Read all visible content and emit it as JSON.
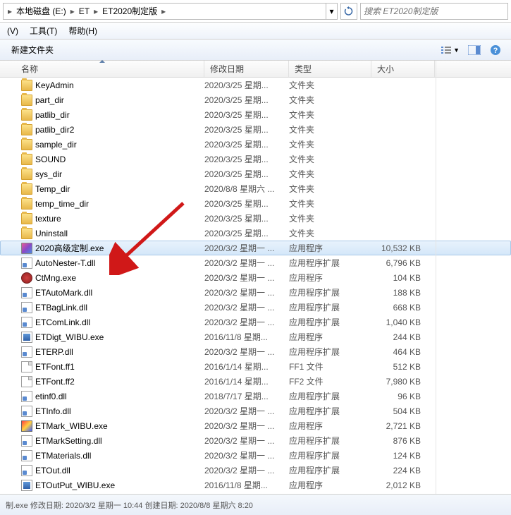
{
  "breadcrumb": {
    "items": [
      "本地磁盘 (E:)",
      "ET",
      "ET2020制定版"
    ]
  },
  "search": {
    "placeholder": "搜索 ET2020制定版"
  },
  "menu": {
    "view": "(V)",
    "tools": "工具(T)",
    "help": "帮助(H)"
  },
  "toolbar": {
    "new_folder": "新建文件夹"
  },
  "columns": {
    "name": "名称",
    "date": "修改日期",
    "type": "类型",
    "size": "大小"
  },
  "rows": [
    {
      "icon": "folder",
      "name": "KeyAdmin",
      "date": "2020/3/25 星期...",
      "type": "文件夹",
      "size": ""
    },
    {
      "icon": "folder",
      "name": "part_dir",
      "date": "2020/3/25 星期...",
      "type": "文件夹",
      "size": ""
    },
    {
      "icon": "folder",
      "name": "patlib_dir",
      "date": "2020/3/25 星期...",
      "type": "文件夹",
      "size": ""
    },
    {
      "icon": "folder",
      "name": "patlib_dir2",
      "date": "2020/3/25 星期...",
      "type": "文件夹",
      "size": ""
    },
    {
      "icon": "folder",
      "name": "sample_dir",
      "date": "2020/3/25 星期...",
      "type": "文件夹",
      "size": ""
    },
    {
      "icon": "folder",
      "name": "SOUND",
      "date": "2020/3/25 星期...",
      "type": "文件夹",
      "size": ""
    },
    {
      "icon": "folder",
      "name": "sys_dir",
      "date": "2020/3/25 星期...",
      "type": "文件夹",
      "size": ""
    },
    {
      "icon": "folder",
      "name": "Temp_dir",
      "date": "2020/8/8 星期六 ...",
      "type": "文件夹",
      "size": ""
    },
    {
      "icon": "folder",
      "name": "temp_time_dir",
      "date": "2020/3/25 星期...",
      "type": "文件夹",
      "size": ""
    },
    {
      "icon": "folder",
      "name": "texture",
      "date": "2020/3/25 星期...",
      "type": "文件夹",
      "size": ""
    },
    {
      "icon": "folder",
      "name": "Uninstall",
      "date": "2020/3/25 星期...",
      "type": "文件夹",
      "size": ""
    },
    {
      "icon": "exe",
      "name": "2020高级定制.exe",
      "date": "2020/3/2 星期一 ...",
      "type": "应用程序",
      "size": "10,532 KB",
      "selected": true
    },
    {
      "icon": "dll",
      "name": "AutoNester-T.dll",
      "date": "2020/3/2 星期一 ...",
      "type": "应用程序扩展",
      "size": "6,796 KB"
    },
    {
      "icon": "gear",
      "name": "CtMng.exe",
      "date": "2020/3/2 星期一 ...",
      "type": "应用程序",
      "size": "104 KB"
    },
    {
      "icon": "dll",
      "name": "ETAutoMark.dll",
      "date": "2020/3/2 星期一 ...",
      "type": "应用程序扩展",
      "size": "188 KB"
    },
    {
      "icon": "dll",
      "name": "ETBagLink.dll",
      "date": "2020/3/2 星期一 ...",
      "type": "应用程序扩展",
      "size": "668 KB"
    },
    {
      "icon": "dll",
      "name": "ETComLink.dll",
      "date": "2020/3/2 星期一 ...",
      "type": "应用程序扩展",
      "size": "1,040 KB"
    },
    {
      "icon": "wibu",
      "name": "ETDigt_WIBU.exe",
      "date": "2016/11/8 星期...",
      "type": "应用程序",
      "size": "244 KB"
    },
    {
      "icon": "dll",
      "name": "ETERP.dll",
      "date": "2020/3/2 星期一 ...",
      "type": "应用程序扩展",
      "size": "464 KB"
    },
    {
      "icon": "file",
      "name": "ETFont.ff1",
      "date": "2016/1/14 星期...",
      "type": "FF1 文件",
      "size": "512 KB"
    },
    {
      "icon": "file",
      "name": "ETFont.ff2",
      "date": "2016/1/14 星期...",
      "type": "FF2 文件",
      "size": "7,980 KB"
    },
    {
      "icon": "dll",
      "name": "etinf0.dll",
      "date": "2018/7/17 星期...",
      "type": "应用程序扩展",
      "size": "96 KB"
    },
    {
      "icon": "dll",
      "name": "ETInfo.dll",
      "date": "2020/3/2 星期一 ...",
      "type": "应用程序扩展",
      "size": "504 KB"
    },
    {
      "icon": "exe2",
      "name": "ETMark_WIBU.exe",
      "date": "2020/3/2 星期一 ...",
      "type": "应用程序",
      "size": "2,721 KB"
    },
    {
      "icon": "dll",
      "name": "ETMarkSetting.dll",
      "date": "2020/3/2 星期一 ...",
      "type": "应用程序扩展",
      "size": "876 KB"
    },
    {
      "icon": "dll",
      "name": "ETMaterials.dll",
      "date": "2020/3/2 星期一 ...",
      "type": "应用程序扩展",
      "size": "124 KB"
    },
    {
      "icon": "dll",
      "name": "ETOut.dll",
      "date": "2020/3/2 星期一 ...",
      "type": "应用程序扩展",
      "size": "224 KB"
    },
    {
      "icon": "wibu",
      "name": "ETOutPut_WIBU.exe",
      "date": "2016/11/8 星期...",
      "type": "应用程序",
      "size": "2,012 KB"
    }
  ],
  "status": {
    "text": "制.exe  修改日期: 2020/3/2 星期一 10:44   创建日期: 2020/8/8 星期六 8:20"
  }
}
